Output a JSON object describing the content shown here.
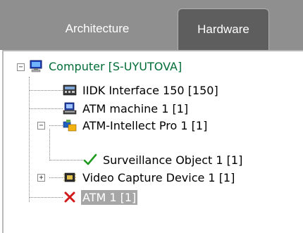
{
  "tabs": [
    {
      "label": "Architecture",
      "active": false
    },
    {
      "label": "Hardware",
      "active": true
    }
  ],
  "tree": {
    "root": {
      "label": "Computer [S-UYUTOVA]",
      "icon": "computer-icon",
      "expanded": true
    },
    "children": [
      {
        "label": "IIDK Interface 150 [150]",
        "icon": "interface-board-icon"
      },
      {
        "label": "ATM machine 1 [1]",
        "icon": "atm-machine-icon"
      },
      {
        "label": "ATM-Intellect Pro 1 [1]",
        "icon": "intellect-module-icon",
        "expanded": true,
        "children": [
          {
            "label": "Surveillance Object 1 [1]",
            "icon": "checkmark-icon"
          }
        ]
      },
      {
        "label": "Video Capture Device 1 [1]",
        "icon": "capture-chip-icon",
        "expanded": false
      },
      {
        "label": "ATM 1 [1]",
        "icon": "red-x-icon",
        "selected": true
      }
    ]
  },
  "colors": {
    "tabbar": "#8f8f8f",
    "active_tab": "#5e5e5e",
    "computer_label": "#006d36",
    "selection": "#a6a6a6"
  }
}
